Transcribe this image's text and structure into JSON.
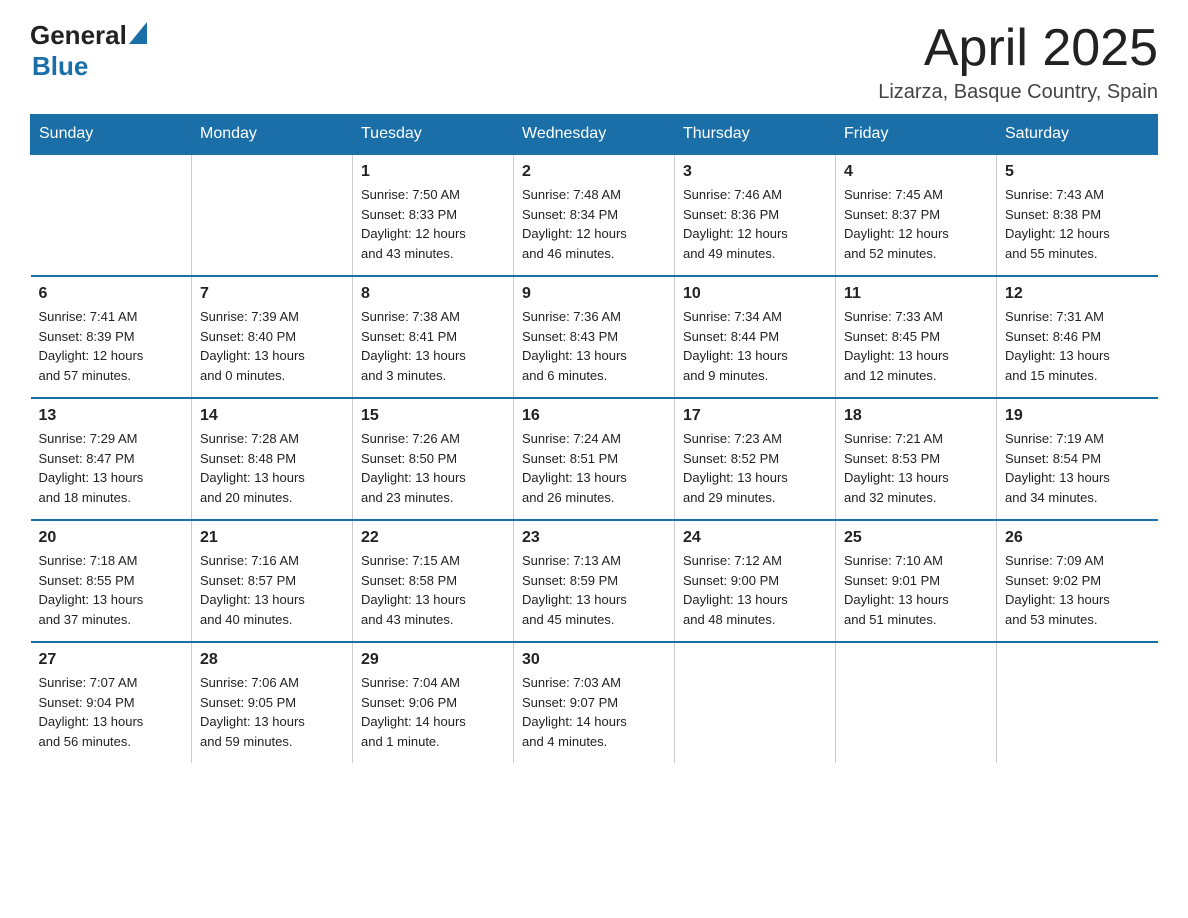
{
  "logo": {
    "text_general": "General",
    "triangle_symbol": "▲",
    "text_blue": "Blue"
  },
  "title": "April 2025",
  "subtitle": "Lizarza, Basque Country, Spain",
  "calendar": {
    "headers": [
      "Sunday",
      "Monday",
      "Tuesday",
      "Wednesday",
      "Thursday",
      "Friday",
      "Saturday"
    ],
    "weeks": [
      [
        {
          "day": "",
          "info": ""
        },
        {
          "day": "",
          "info": ""
        },
        {
          "day": "1",
          "info": "Sunrise: 7:50 AM\nSunset: 8:33 PM\nDaylight: 12 hours\nand 43 minutes."
        },
        {
          "day": "2",
          "info": "Sunrise: 7:48 AM\nSunset: 8:34 PM\nDaylight: 12 hours\nand 46 minutes."
        },
        {
          "day": "3",
          "info": "Sunrise: 7:46 AM\nSunset: 8:36 PM\nDaylight: 12 hours\nand 49 minutes."
        },
        {
          "day": "4",
          "info": "Sunrise: 7:45 AM\nSunset: 8:37 PM\nDaylight: 12 hours\nand 52 minutes."
        },
        {
          "day": "5",
          "info": "Sunrise: 7:43 AM\nSunset: 8:38 PM\nDaylight: 12 hours\nand 55 minutes."
        }
      ],
      [
        {
          "day": "6",
          "info": "Sunrise: 7:41 AM\nSunset: 8:39 PM\nDaylight: 12 hours\nand 57 minutes."
        },
        {
          "day": "7",
          "info": "Sunrise: 7:39 AM\nSunset: 8:40 PM\nDaylight: 13 hours\nand 0 minutes."
        },
        {
          "day": "8",
          "info": "Sunrise: 7:38 AM\nSunset: 8:41 PM\nDaylight: 13 hours\nand 3 minutes."
        },
        {
          "day": "9",
          "info": "Sunrise: 7:36 AM\nSunset: 8:43 PM\nDaylight: 13 hours\nand 6 minutes."
        },
        {
          "day": "10",
          "info": "Sunrise: 7:34 AM\nSunset: 8:44 PM\nDaylight: 13 hours\nand 9 minutes."
        },
        {
          "day": "11",
          "info": "Sunrise: 7:33 AM\nSunset: 8:45 PM\nDaylight: 13 hours\nand 12 minutes."
        },
        {
          "day": "12",
          "info": "Sunrise: 7:31 AM\nSunset: 8:46 PM\nDaylight: 13 hours\nand 15 minutes."
        }
      ],
      [
        {
          "day": "13",
          "info": "Sunrise: 7:29 AM\nSunset: 8:47 PM\nDaylight: 13 hours\nand 18 minutes."
        },
        {
          "day": "14",
          "info": "Sunrise: 7:28 AM\nSunset: 8:48 PM\nDaylight: 13 hours\nand 20 minutes."
        },
        {
          "day": "15",
          "info": "Sunrise: 7:26 AM\nSunset: 8:50 PM\nDaylight: 13 hours\nand 23 minutes."
        },
        {
          "day": "16",
          "info": "Sunrise: 7:24 AM\nSunset: 8:51 PM\nDaylight: 13 hours\nand 26 minutes."
        },
        {
          "day": "17",
          "info": "Sunrise: 7:23 AM\nSunset: 8:52 PM\nDaylight: 13 hours\nand 29 minutes."
        },
        {
          "day": "18",
          "info": "Sunrise: 7:21 AM\nSunset: 8:53 PM\nDaylight: 13 hours\nand 32 minutes."
        },
        {
          "day": "19",
          "info": "Sunrise: 7:19 AM\nSunset: 8:54 PM\nDaylight: 13 hours\nand 34 minutes."
        }
      ],
      [
        {
          "day": "20",
          "info": "Sunrise: 7:18 AM\nSunset: 8:55 PM\nDaylight: 13 hours\nand 37 minutes."
        },
        {
          "day": "21",
          "info": "Sunrise: 7:16 AM\nSunset: 8:57 PM\nDaylight: 13 hours\nand 40 minutes."
        },
        {
          "day": "22",
          "info": "Sunrise: 7:15 AM\nSunset: 8:58 PM\nDaylight: 13 hours\nand 43 minutes."
        },
        {
          "day": "23",
          "info": "Sunrise: 7:13 AM\nSunset: 8:59 PM\nDaylight: 13 hours\nand 45 minutes."
        },
        {
          "day": "24",
          "info": "Sunrise: 7:12 AM\nSunset: 9:00 PM\nDaylight: 13 hours\nand 48 minutes."
        },
        {
          "day": "25",
          "info": "Sunrise: 7:10 AM\nSunset: 9:01 PM\nDaylight: 13 hours\nand 51 minutes."
        },
        {
          "day": "26",
          "info": "Sunrise: 7:09 AM\nSunset: 9:02 PM\nDaylight: 13 hours\nand 53 minutes."
        }
      ],
      [
        {
          "day": "27",
          "info": "Sunrise: 7:07 AM\nSunset: 9:04 PM\nDaylight: 13 hours\nand 56 minutes."
        },
        {
          "day": "28",
          "info": "Sunrise: 7:06 AM\nSunset: 9:05 PM\nDaylight: 13 hours\nand 59 minutes."
        },
        {
          "day": "29",
          "info": "Sunrise: 7:04 AM\nSunset: 9:06 PM\nDaylight: 14 hours\nand 1 minute."
        },
        {
          "day": "30",
          "info": "Sunrise: 7:03 AM\nSunset: 9:07 PM\nDaylight: 14 hours\nand 4 minutes."
        },
        {
          "day": "",
          "info": ""
        },
        {
          "day": "",
          "info": ""
        },
        {
          "day": "",
          "info": ""
        }
      ]
    ]
  }
}
